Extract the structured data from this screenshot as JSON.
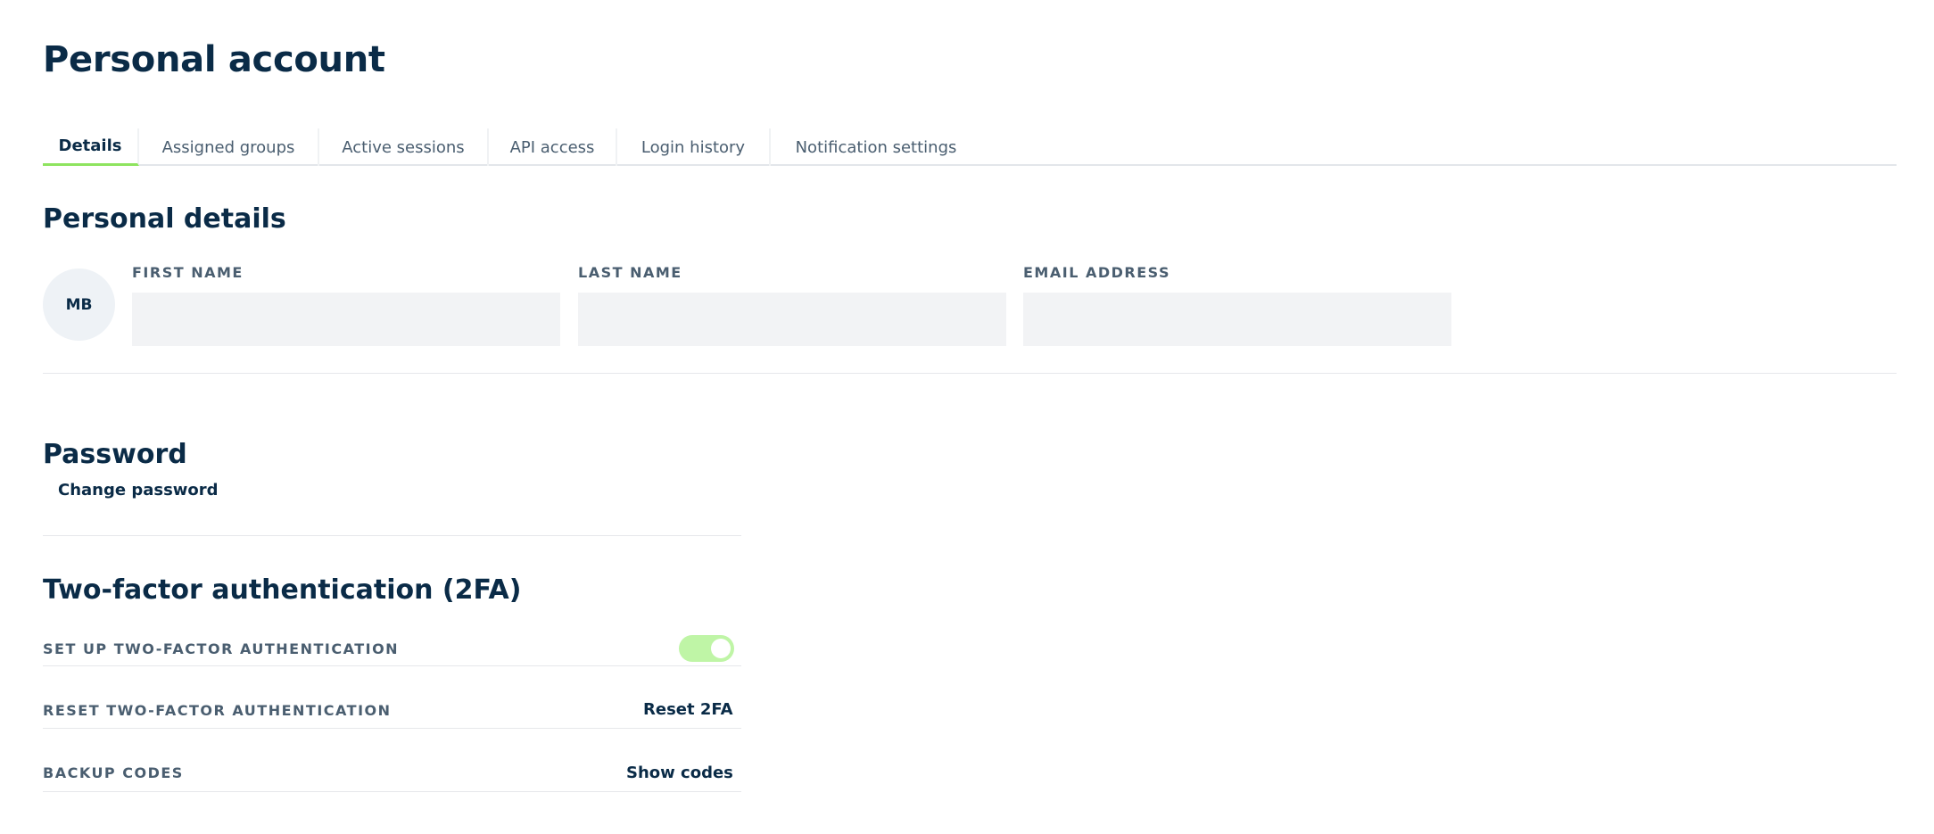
{
  "page": {
    "title": "Personal account"
  },
  "tabs": [
    {
      "label": "Details",
      "active": true
    },
    {
      "label": "Assigned groups",
      "active": false
    },
    {
      "label": "Active sessions",
      "active": false
    },
    {
      "label": "API access",
      "active": false
    },
    {
      "label": "Login history",
      "active": false
    },
    {
      "label": "Notification settings",
      "active": false
    }
  ],
  "personal_details": {
    "title": "Personal details",
    "avatar_initials": "MB",
    "first_name": {
      "label": "FIRST NAME",
      "value": ""
    },
    "last_name": {
      "label": "LAST NAME",
      "value": ""
    },
    "email": {
      "label": "EMAIL ADDRESS",
      "value": ""
    }
  },
  "password": {
    "title": "Password",
    "change_label": "Change password"
  },
  "two_factor": {
    "title": "Two-factor authentication (2FA)",
    "setup_label": "SET UP TWO-FACTOR AUTHENTICATION",
    "setup_enabled": true,
    "reset_label": "RESET TWO-FACTOR AUTHENTICATION",
    "reset_button": "Reset 2FA",
    "backup_label": "BACKUP CODES",
    "backup_button": "Show codes"
  },
  "colors": {
    "accent": "#8ee45f",
    "toggle_on": "#bff5a6",
    "text_primary": "#0a2b47",
    "text_secondary": "#4a5e70"
  }
}
